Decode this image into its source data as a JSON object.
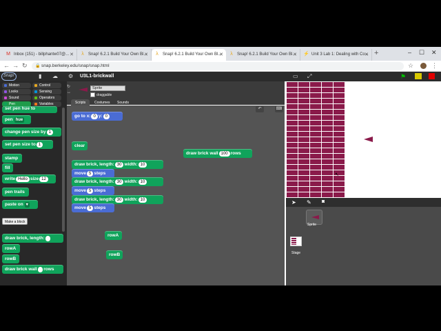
{
  "browser": {
    "tabs": [
      {
        "label": "Inbox (151) - billphantw07@...",
        "active": false,
        "fav": "M"
      },
      {
        "label": "Snap! 6.2.1 Build Your Own Bl...",
        "active": false,
        "fav": "λ"
      },
      {
        "label": "Snap! 6.2.1 Build Your Own Bl...",
        "active": true,
        "fav": "λ"
      },
      {
        "label": "Snap! 6.2.1 Build Your Own Bl...",
        "active": false,
        "fav": "λ"
      },
      {
        "label": "Snap! 6.2.1 Build Your Own Bl...",
        "active": false,
        "fav": "λ"
      },
      {
        "label": "Unit 3 Lab 1: Dealing with Co...",
        "active": false,
        "fav": "⚡"
      }
    ],
    "new_tab": "+",
    "url": "snap.berkeley.edu/snap/snap.html"
  },
  "snap": {
    "project_title": "U3L1-brickwall",
    "logo": "Snap!",
    "categories": [
      {
        "label": "Motion",
        "color": "#4a6cd4"
      },
      {
        "label": "Control",
        "color": "#e6a822"
      },
      {
        "label": "Looks",
        "color": "#8f56e3"
      },
      {
        "label": "Sensing",
        "color": "#0494dc"
      },
      {
        "label": "Sound",
        "color": "#cf4ad9"
      },
      {
        "label": "Operators",
        "color": "#62c213"
      },
      {
        "label": "Pen",
        "color": "#10a35b"
      },
      {
        "label": "Variables",
        "color": "#f3761d"
      }
    ],
    "palette": {
      "set_pen": "set pen hue",
      "set_pen_to": "to",
      "pen_hue": "pen",
      "pen_hue_dd": "hue",
      "change_pen_size": "change pen size by",
      "change_pen_size_val": "1",
      "set_pen_size": "set pen size to",
      "set_pen_size_val": "1",
      "stamp": "stamp",
      "fill": "fill",
      "write": "write",
      "write_text": "Hello",
      "write_size": "size",
      "write_size_val": "12",
      "pen_trails": "pen trails",
      "paste_on": "paste on",
      "make_block": "Make a block",
      "draw_brick": "draw brick, length:",
      "rowA": "rowA",
      "rowB": "rowB",
      "draw_brick_wall": "draw brick wall",
      "rows": "rows"
    },
    "sprite": {
      "name": "Sprite",
      "draggable": "draggable",
      "tabs": [
        "Scripts",
        "Costumes",
        "Sounds"
      ]
    },
    "scripts": {
      "goto_label": "go to x:",
      "goto_x": "0",
      "goto_y_label": "y:",
      "goto_y": "0",
      "clear": "clear",
      "draw_brick_label": "draw brick, length:",
      "width_label": "width:",
      "b1_len": "30",
      "b1_w": "10",
      "move_label": "move",
      "steps_label": "steps",
      "m1": "5",
      "b2_len": "30",
      "b2_w": "10",
      "m2": "5",
      "b3_len": "30",
      "b3_w": "10",
      "m3": "5",
      "wall_label": "draw brick wall",
      "wall_rows": "100",
      "rows_label": "rows",
      "rowA": "rowA",
      "rowB": "rowB"
    },
    "corral": {
      "sprite_label": "Sprite",
      "stage_label": "Stage"
    }
  }
}
